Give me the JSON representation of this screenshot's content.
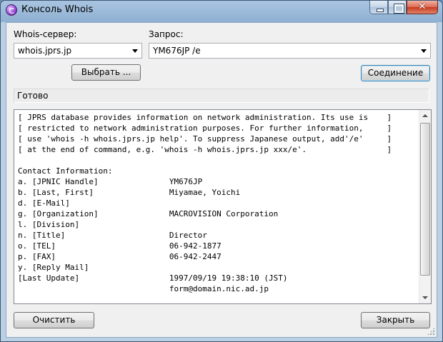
{
  "window": {
    "title": "Консоль Whois",
    "icon": "whois-app-icon",
    "controls": {
      "minimize": "minimize-icon",
      "maximize": "maximize-icon",
      "close": "✕"
    }
  },
  "form": {
    "server_label": "Whois-сервер:",
    "server_value": "whois.jprs.jp",
    "query_label": "Запрос:",
    "query_value": "YM676JP /e",
    "select_button": "Выбрать ...",
    "connect_button": "Соединение"
  },
  "status": {
    "text": "Готово"
  },
  "output": {
    "lines": [
      "[ JPRS database provides information on network administration. Its use is    ]",
      "[ restricted to network administration purposes. For further information,     ]",
      "[ use 'whois -h whois.jprs.jp help'. To suppress Japanese output, add'/e'     ]",
      "[ at the end of command, e.g. 'whois -h whois.jprs.jp xxx/e'.                 ]",
      "",
      "Contact Information:",
      "a. [JPNIC Handle]               YM676JP",
      "b. [Last, First]                Miyamae, Yoichi",
      "d. [E-Mail]",
      "g. [Organization]               MACROVISION Corporation",
      "l. [Division]",
      "n. [Title]                      Director",
      "o. [TEL]                        06-942-1877",
      "p. [FAX]                        06-942-2447",
      "y. [Reply Mail]",
      "[Last Update]                   1997/09/19 19:38:10 (JST)",
      "                                form@domain.nic.ad.jp"
    ]
  },
  "footer": {
    "clear_button": "Очистить",
    "close_button": "Закрыть"
  },
  "colors": {
    "titlebar": "#a9c4e0",
    "client_bg": "#f0f0f0",
    "default_button_border": "#3c7fb1",
    "close_button": "#c5391f"
  }
}
